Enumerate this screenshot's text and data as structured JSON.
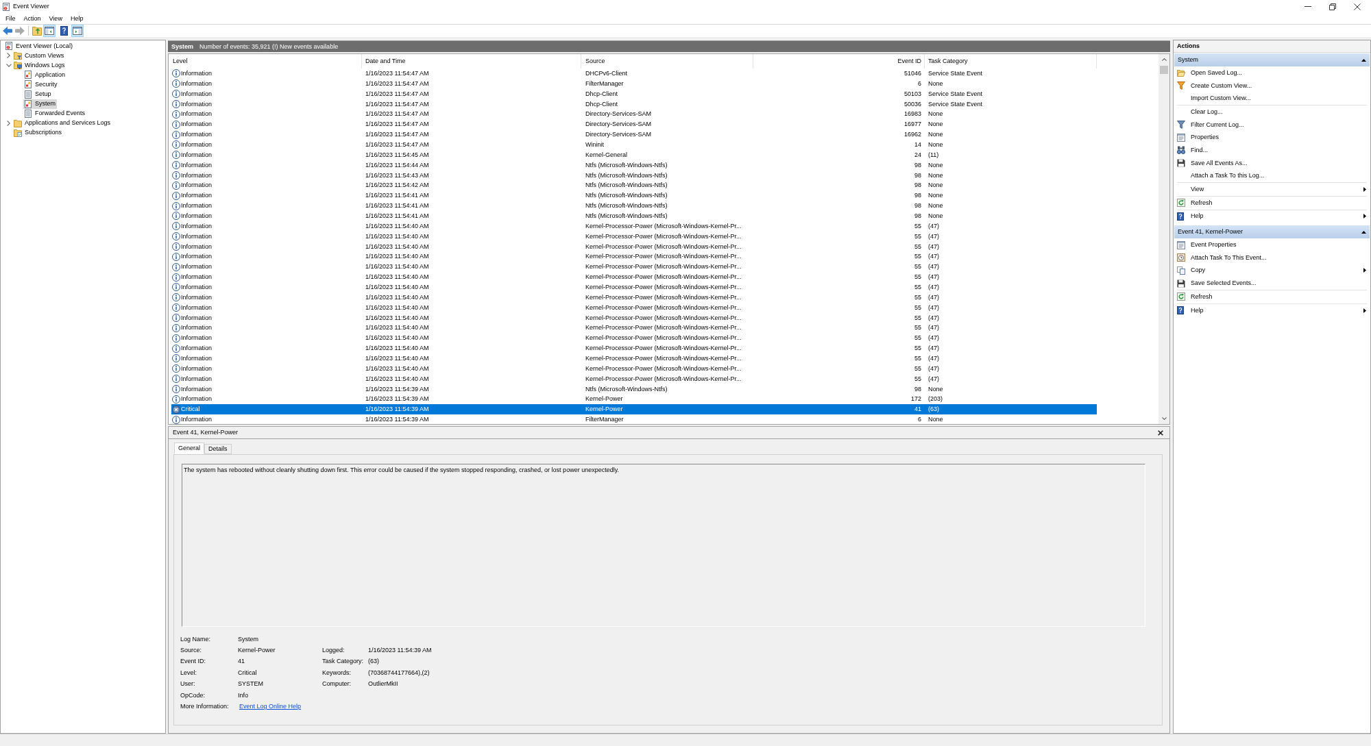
{
  "window": {
    "title": "Event Viewer"
  },
  "menu": [
    "File",
    "Action",
    "View",
    "Help"
  ],
  "toolbar": {
    "buttons": [
      {
        "pressed": false,
        "disabled": false
      },
      {
        "pressed": false,
        "disabled": true
      },
      {
        "pressed": false,
        "disabled": false
      },
      {
        "pressed": true,
        "disabled": false
      },
      {
        "pressed": false,
        "disabled": false
      },
      {
        "pressed": true,
        "disabled": false
      }
    ]
  },
  "navigation_tree": [
    {
      "label": "Event Viewer (Local)",
      "selected": false,
      "children": [
        {
          "label": "Custom Views",
          "expanded": false,
          "selected": false
        },
        {
          "label": "Windows Logs",
          "expanded": true,
          "selected": false,
          "children": [
            {
              "label": "Application",
              "selected": false
            },
            {
              "label": "Security",
              "selected": false
            },
            {
              "label": "Setup",
              "selected": false
            },
            {
              "label": "System",
              "selected": true
            },
            {
              "label": "Forwarded Events",
              "selected": false
            }
          ]
        },
        {
          "label": "Applications and Services Logs",
          "expanded": false,
          "selected": false
        },
        {
          "label": "Subscriptions",
          "selected": false
        }
      ]
    }
  ],
  "log_header": {
    "title": "System",
    "summary": "Number of events: 35,921 (!) New events available"
  },
  "table": {
    "columns": [
      "Level",
      "Date and Time",
      "Source",
      "Event ID",
      "Task Category"
    ],
    "rows": [
      {
        "kind": "information",
        "selected": false,
        "cells": [
          "Information",
          "1/16/2023 11:54:47 AM",
          "DHCPv6-Client",
          "51046",
          "Service State Event"
        ]
      },
      {
        "kind": "information",
        "selected": false,
        "cells": [
          "Information",
          "1/16/2023 11:54:47 AM",
          "FilterManager",
          "6",
          "None"
        ]
      },
      {
        "kind": "information",
        "selected": false,
        "cells": [
          "Information",
          "1/16/2023 11:54:47 AM",
          "Dhcp-Client",
          "50103",
          "Service State Event"
        ]
      },
      {
        "kind": "information",
        "selected": false,
        "cells": [
          "Information",
          "1/16/2023 11:54:47 AM",
          "Dhcp-Client",
          "50036",
          "Service State Event"
        ]
      },
      {
        "kind": "information",
        "selected": false,
        "cells": [
          "Information",
          "1/16/2023 11:54:47 AM",
          "Directory-Services-SAM",
          "16983",
          "None"
        ]
      },
      {
        "kind": "information",
        "selected": false,
        "cells": [
          "Information",
          "1/16/2023 11:54:47 AM",
          "Directory-Services-SAM",
          "16977",
          "None"
        ]
      },
      {
        "kind": "information",
        "selected": false,
        "cells": [
          "Information",
          "1/16/2023 11:54:47 AM",
          "Directory-Services-SAM",
          "16962",
          "None"
        ]
      },
      {
        "kind": "information",
        "selected": false,
        "cells": [
          "Information",
          "1/16/2023 11:54:47 AM",
          "Wininit",
          "14",
          "None"
        ]
      },
      {
        "kind": "information",
        "selected": false,
        "cells": [
          "Information",
          "1/16/2023 11:54:45 AM",
          "Kernel-General",
          "24",
          "(11)"
        ]
      },
      {
        "kind": "information",
        "selected": false,
        "cells": [
          "Information",
          "1/16/2023 11:54:44 AM",
          "Ntfs (Microsoft-Windows-Ntfs)",
          "98",
          "None"
        ]
      },
      {
        "kind": "information",
        "selected": false,
        "cells": [
          "Information",
          "1/16/2023 11:54:43 AM",
          "Ntfs (Microsoft-Windows-Ntfs)",
          "98",
          "None"
        ]
      },
      {
        "kind": "information",
        "selected": false,
        "cells": [
          "Information",
          "1/16/2023 11:54:42 AM",
          "Ntfs (Microsoft-Windows-Ntfs)",
          "98",
          "None"
        ]
      },
      {
        "kind": "information",
        "selected": false,
        "cells": [
          "Information",
          "1/16/2023 11:54:41 AM",
          "Ntfs (Microsoft-Windows-Ntfs)",
          "98",
          "None"
        ]
      },
      {
        "kind": "information",
        "selected": false,
        "cells": [
          "Information",
          "1/16/2023 11:54:41 AM",
          "Ntfs (Microsoft-Windows-Ntfs)",
          "98",
          "None"
        ]
      },
      {
        "kind": "information",
        "selected": false,
        "cells": [
          "Information",
          "1/16/2023 11:54:41 AM",
          "Ntfs (Microsoft-Windows-Ntfs)",
          "98",
          "None"
        ]
      },
      {
        "kind": "information",
        "selected": false,
        "cells": [
          "Information",
          "1/16/2023 11:54:40 AM",
          "Kernel-Processor-Power (Microsoft-Windows-Kernel-Pr...",
          "55",
          "(47)"
        ]
      },
      {
        "kind": "information",
        "selected": false,
        "cells": [
          "Information",
          "1/16/2023 11:54:40 AM",
          "Kernel-Processor-Power (Microsoft-Windows-Kernel-Pr...",
          "55",
          "(47)"
        ]
      },
      {
        "kind": "information",
        "selected": false,
        "cells": [
          "Information",
          "1/16/2023 11:54:40 AM",
          "Kernel-Processor-Power (Microsoft-Windows-Kernel-Pr...",
          "55",
          "(47)"
        ]
      },
      {
        "kind": "information",
        "selected": false,
        "cells": [
          "Information",
          "1/16/2023 11:54:40 AM",
          "Kernel-Processor-Power (Microsoft-Windows-Kernel-Pr...",
          "55",
          "(47)"
        ]
      },
      {
        "kind": "information",
        "selected": false,
        "cells": [
          "Information",
          "1/16/2023 11:54:40 AM",
          "Kernel-Processor-Power (Microsoft-Windows-Kernel-Pr...",
          "55",
          "(47)"
        ]
      },
      {
        "kind": "information",
        "selected": false,
        "cells": [
          "Information",
          "1/16/2023 11:54:40 AM",
          "Kernel-Processor-Power (Microsoft-Windows-Kernel-Pr...",
          "55",
          "(47)"
        ]
      },
      {
        "kind": "information",
        "selected": false,
        "cells": [
          "Information",
          "1/16/2023 11:54:40 AM",
          "Kernel-Processor-Power (Microsoft-Windows-Kernel-Pr...",
          "55",
          "(47)"
        ]
      },
      {
        "kind": "information",
        "selected": false,
        "cells": [
          "Information",
          "1/16/2023 11:54:40 AM",
          "Kernel-Processor-Power (Microsoft-Windows-Kernel-Pr...",
          "55",
          "(47)"
        ]
      },
      {
        "kind": "information",
        "selected": false,
        "cells": [
          "Information",
          "1/16/2023 11:54:40 AM",
          "Kernel-Processor-Power (Microsoft-Windows-Kernel-Pr...",
          "55",
          "(47)"
        ]
      },
      {
        "kind": "information",
        "selected": false,
        "cells": [
          "Information",
          "1/16/2023 11:54:40 AM",
          "Kernel-Processor-Power (Microsoft-Windows-Kernel-Pr...",
          "55",
          "(47)"
        ]
      },
      {
        "kind": "information",
        "selected": false,
        "cells": [
          "Information",
          "1/16/2023 11:54:40 AM",
          "Kernel-Processor-Power (Microsoft-Windows-Kernel-Pr...",
          "55",
          "(47)"
        ]
      },
      {
        "kind": "information",
        "selected": false,
        "cells": [
          "Information",
          "1/16/2023 11:54:40 AM",
          "Kernel-Processor-Power (Microsoft-Windows-Kernel-Pr...",
          "55",
          "(47)"
        ]
      },
      {
        "kind": "information",
        "selected": false,
        "cells": [
          "Information",
          "1/16/2023 11:54:40 AM",
          "Kernel-Processor-Power (Microsoft-Windows-Kernel-Pr...",
          "55",
          "(47)"
        ]
      },
      {
        "kind": "information",
        "selected": false,
        "cells": [
          "Information",
          "1/16/2023 11:54:40 AM",
          "Kernel-Processor-Power (Microsoft-Windows-Kernel-Pr...",
          "55",
          "(47)"
        ]
      },
      {
        "kind": "information",
        "selected": false,
        "cells": [
          "Information",
          "1/16/2023 11:54:40 AM",
          "Kernel-Processor-Power (Microsoft-Windows-Kernel-Pr...",
          "55",
          "(47)"
        ]
      },
      {
        "kind": "information",
        "selected": false,
        "cells": [
          "Information",
          "1/16/2023 11:54:40 AM",
          "Kernel-Processor-Power (Microsoft-Windows-Kernel-Pr...",
          "55",
          "(47)"
        ]
      },
      {
        "kind": "information",
        "selected": false,
        "cells": [
          "Information",
          "1/16/2023 11:54:39 AM",
          "Ntfs (Microsoft-Windows-Ntfs)",
          "98",
          "None"
        ]
      },
      {
        "kind": "information",
        "selected": false,
        "cells": [
          "Information",
          "1/16/2023 11:54:39 AM",
          "Kernel-Power",
          "172",
          "(203)"
        ]
      },
      {
        "kind": "critical",
        "selected": true,
        "cells": [
          "Critical",
          "1/16/2023 11:54:39 AM",
          "Kernel-Power",
          "41",
          "(63)"
        ]
      },
      {
        "kind": "information",
        "selected": false,
        "cells": [
          "Information",
          "1/16/2023 11:54:39 AM",
          "FilterManager",
          "6",
          "None"
        ]
      }
    ]
  },
  "details": {
    "title": "Event 41, Kernel-Power",
    "tabs": [
      {
        "label": "General",
        "selected": true
      },
      {
        "label": "Details",
        "selected": false
      }
    ],
    "description": "The system has rebooted without cleanly shutting down first. This error could be caused if the system stopped responding, crashed, or lost power unexpectedly.",
    "fields_left": [
      {
        "label": "Log Name:",
        "value": "System"
      },
      {
        "label": "Source:",
        "value": "Kernel-Power"
      },
      {
        "label": "Event ID:",
        "value": "41"
      },
      {
        "label": "Level:",
        "value": "Critical"
      },
      {
        "label": "User:",
        "value": "SYSTEM"
      },
      {
        "label": "OpCode:",
        "value": "Info"
      }
    ],
    "fields_right": [
      {
        "label": "Logged:",
        "value": "1/16/2023 11:54:39 AM"
      },
      {
        "label": "Task Category:",
        "value": "(63)"
      },
      {
        "label": "Keywords:",
        "value": "(70368744177664),(2)"
      },
      {
        "label": "Computer:",
        "value": "OutlierMkII"
      }
    ],
    "more_information": {
      "label": "More Information:",
      "link": "Event Log Online Help"
    }
  },
  "actions": {
    "title": "Actions",
    "sections": [
      {
        "title": "System",
        "expanded": true,
        "groups": [
          [
            {
              "label": "Open Saved Log...",
              "has_submenu": false
            },
            {
              "label": "Create Custom View...",
              "has_submenu": false
            },
            {
              "label": "Import Custom View...",
              "has_submenu": false
            }
          ],
          [
            {
              "label": "Clear Log...",
              "has_submenu": false
            },
            {
              "label": "Filter Current Log...",
              "has_submenu": false
            },
            {
              "label": "Properties",
              "has_submenu": false
            },
            {
              "label": "Find...",
              "has_submenu": false
            },
            {
              "label": "Save All Events As...",
              "has_submenu": false
            },
            {
              "label": "Attach a Task To this Log...",
              "has_submenu": false
            }
          ],
          [
            {
              "label": "View",
              "has_submenu": true
            }
          ],
          [
            {
              "label": "Refresh",
              "has_submenu": false
            }
          ],
          [
            {
              "label": "Help",
              "has_submenu": true
            }
          ]
        ]
      },
      {
        "title": "Event 41, Kernel-Power",
        "expanded": true,
        "groups": [
          [
            {
              "label": "Event Properties",
              "has_submenu": false
            },
            {
              "label": "Attach Task To This Event...",
              "has_submenu": false
            },
            {
              "label": "Copy",
              "has_submenu": true
            },
            {
              "label": "Save Selected Events...",
              "has_submenu": false
            }
          ],
          [
            {
              "label": "Refresh",
              "has_submenu": false
            }
          ],
          [
            {
              "label": "Help",
              "has_submenu": true
            }
          ]
        ]
      }
    ]
  }
}
